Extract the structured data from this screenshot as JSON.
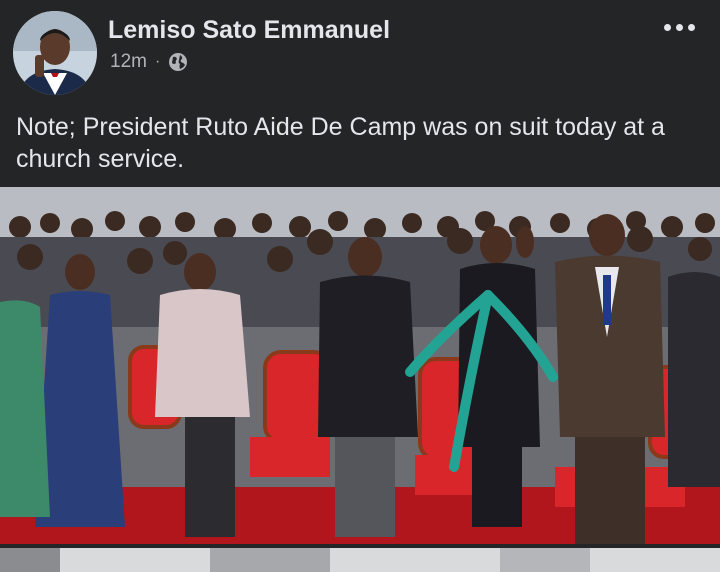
{
  "post": {
    "author": "Lemiso Sato Emmanuel",
    "time": "12m",
    "separator": "·",
    "privacy_icon": "globe-icon",
    "more_icon": "more-options-icon",
    "text": "Note; President Ruto Aide De Camp was on suit today at a church service."
  },
  "colors": {
    "background": "#242526",
    "text": "#e4e6eb",
    "secondary_text": "#b0b3b8",
    "arrow": "#23a394",
    "chair_red": "#d8262a"
  }
}
